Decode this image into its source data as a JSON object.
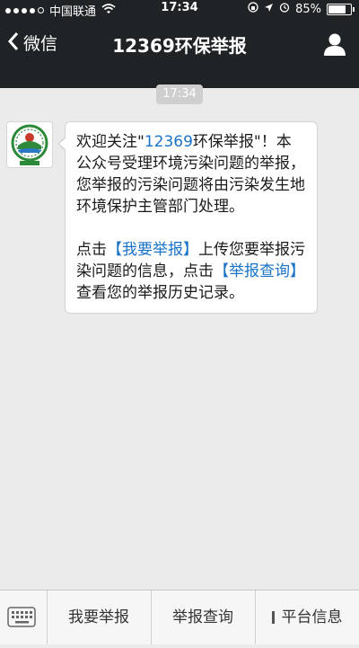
{
  "status": {
    "carrier": "中国联通",
    "time": "17:34",
    "battery": "85%",
    "battery_level": 0.85,
    "signal_bars": 4
  },
  "nav": {
    "back_label": "微信",
    "title": "12369环保举报"
  },
  "chat": {
    "timestamp": "17:34",
    "message": {
      "p1_prefix": "欢迎关注\"",
      "p1_link": "12369",
      "p1_suffix": "环保举报\"！本公众号受理环境污染问题的举报，您举报的污染问题将由污染发生地环境保护主管部门处理。",
      "p2_a": "点击",
      "p2_link1": "【我要举报】",
      "p2_b": "上传您要举报污染问题的信息，点击",
      "p2_link2": "【举报查询】",
      "p2_c": "查看您的举报历史记录。"
    }
  },
  "menu": {
    "items": [
      "我要举报",
      "举报查询",
      "平台信息"
    ]
  },
  "colors": {
    "nav_bg": "#1f2326",
    "link": "#1b73c7",
    "chat_bg": "#ebebeb"
  }
}
